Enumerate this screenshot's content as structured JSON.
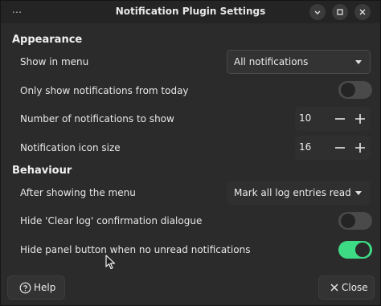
{
  "window": {
    "title": "Notification Plugin Settings",
    "menu_glyph": "⋯",
    "controls": [
      "minimize-icon",
      "maximize-icon",
      "close-icon"
    ]
  },
  "appearance": {
    "heading": "Appearance",
    "show_in_menu": {
      "label": "Show in menu",
      "value": "All notifications"
    },
    "only_today": {
      "label": "Only show notifications from today",
      "enabled": false
    },
    "count": {
      "label": "Number of notifications to show",
      "value": "10"
    },
    "icon_size": {
      "label": "Notification icon size",
      "value": "16"
    }
  },
  "behaviour": {
    "heading": "Behaviour",
    "after_showing": {
      "label": "After showing the menu",
      "value": "Mark all log entries read"
    },
    "hide_clear_confirm": {
      "label": "Hide 'Clear log' confirmation dialogue",
      "enabled": false
    },
    "hide_panel_button": {
      "label": "Hide panel button when no unread notifications",
      "enabled": true
    }
  },
  "footer": {
    "help_label": "Help",
    "close_label": "Close"
  },
  "colors": {
    "accent_green": "#3ddc84",
    "background": "#2b2b2b"
  }
}
